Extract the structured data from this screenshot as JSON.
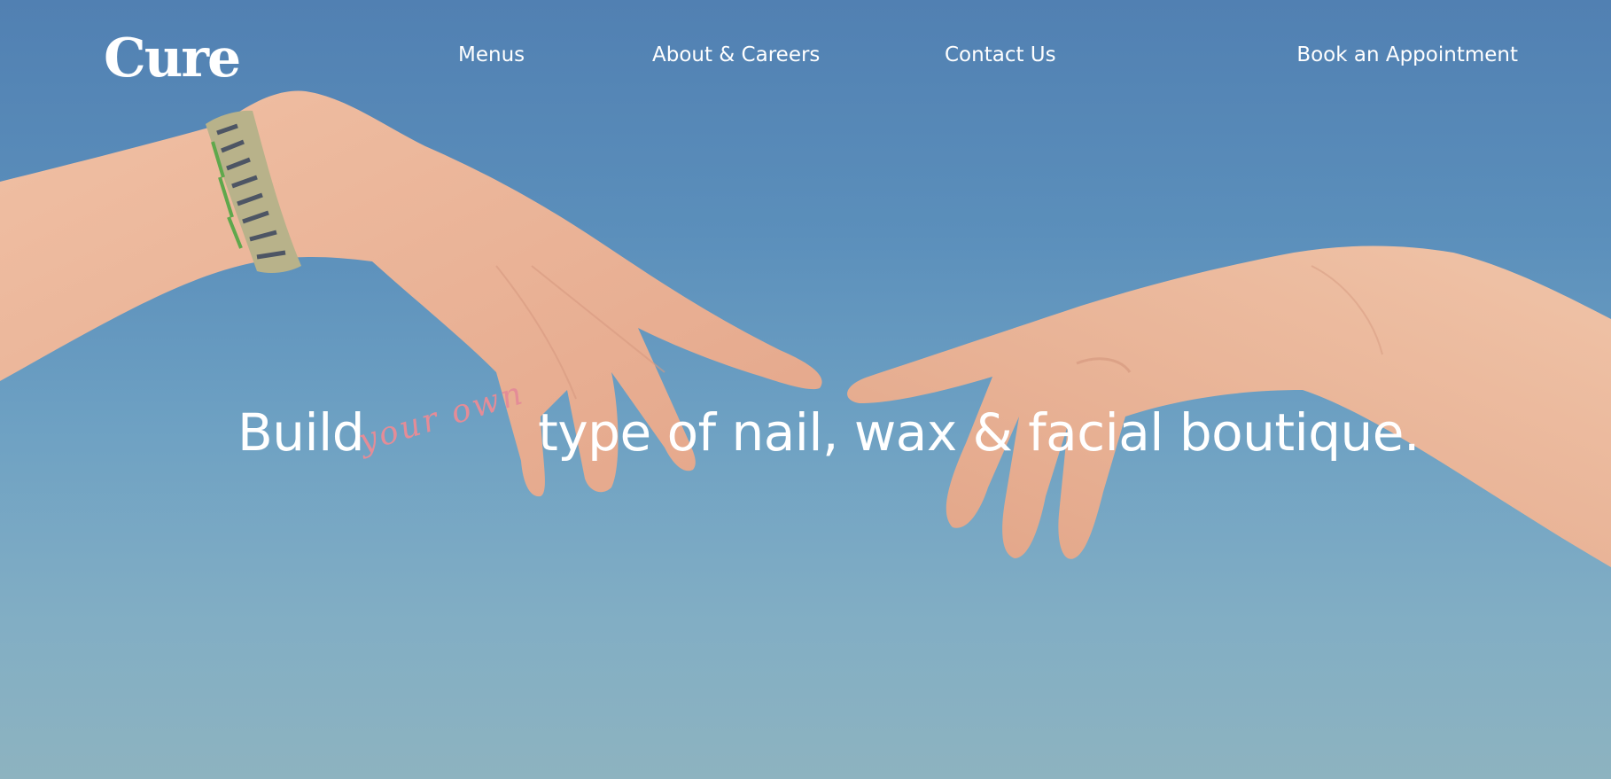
{
  "brand": {
    "logo": "Cure"
  },
  "nav": {
    "menus": "Menus",
    "about": "About & Careers",
    "contact": "Contact Us",
    "book": "Book an Appointment"
  },
  "hero": {
    "headline_start": "Build",
    "headline_accent": "your own",
    "headline_end": "type of nail, wax & facial boutique.",
    "image": "two-hands-reaching-against-blue-sky",
    "colors": {
      "sky_top": "#5180b2",
      "sky_bottom": "#8db3c0",
      "accent_text": "#e48c97",
      "skin": "#efb99d"
    }
  }
}
